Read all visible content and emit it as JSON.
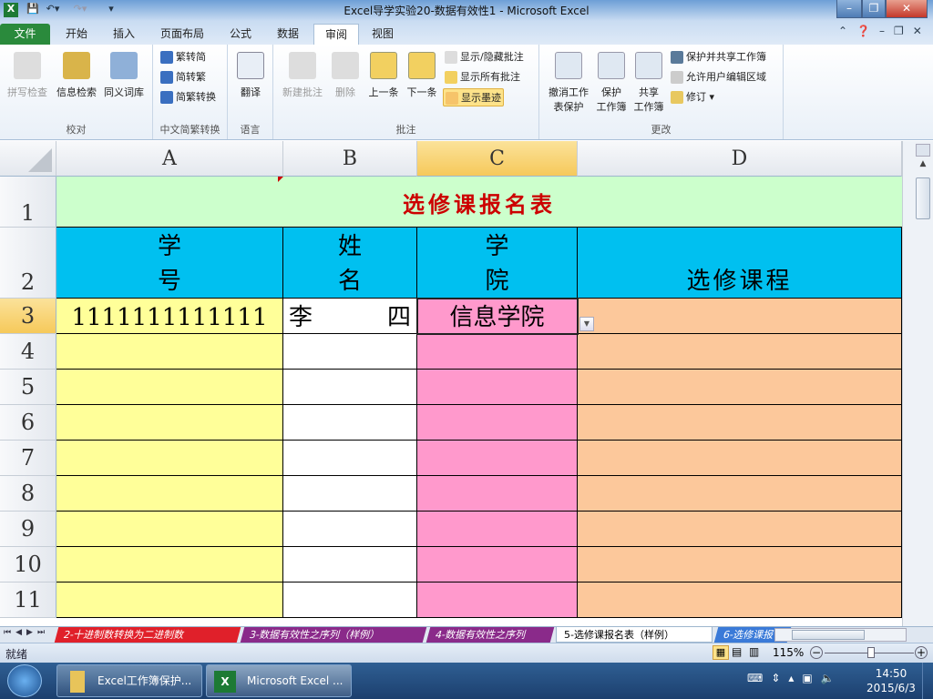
{
  "window": {
    "title": "Excel导学实验20-数据有效性1 - Microsoft Excel"
  },
  "tabs": [
    {
      "label": "文件"
    },
    {
      "label": "开始"
    },
    {
      "label": "插入"
    },
    {
      "label": "页面布局"
    },
    {
      "label": "公式"
    },
    {
      "label": "数据"
    },
    {
      "label": "审阅"
    },
    {
      "label": "视图"
    }
  ],
  "active_tab": "审阅",
  "ribbon": {
    "proofing": {
      "label": "校对",
      "items": [
        "拼写检查",
        "信息检索",
        "同义词库"
      ]
    },
    "chinese": {
      "label": "中文简繁转换",
      "items": [
        "繁转简",
        "简转繁",
        "简繁转换"
      ]
    },
    "language": {
      "label": "语言",
      "items": [
        "翻译"
      ]
    },
    "comments": {
      "label": "批注",
      "items": [
        "新建批注",
        "删除",
        "上一条",
        "下一条"
      ],
      "small": [
        "显示/隐藏批注",
        "显示所有批注",
        "显示墨迹"
      ]
    },
    "changes": {
      "label": "更改",
      "items": [
        "撤消工作表保护",
        "保护工作簿",
        "共享工作簿"
      ],
      "item_lines": [
        [
          "撤消工作",
          "表保护"
        ],
        [
          "保护",
          "工作簿"
        ],
        [
          "共享",
          "工作簿"
        ]
      ],
      "small": [
        "保护并共享工作簿",
        "允许用户编辑区域",
        "修订"
      ]
    }
  },
  "sheet": {
    "columns": [
      "A",
      "B",
      "C",
      "D"
    ],
    "selected_cell": "C3",
    "rows": [
      "1",
      "2",
      "3",
      "4",
      "5",
      "6",
      "7",
      "8",
      "9",
      "10",
      "11"
    ],
    "title": "选修课报名表",
    "headers": {
      "a": [
        "学",
        "号"
      ],
      "b": [
        "姓",
        "名"
      ],
      "c": [
        "学",
        "院"
      ],
      "d": "选修课程"
    },
    "row3": {
      "a": "1111111111111",
      "b1": "李",
      "b2": "四",
      "c": "信息学院",
      "d": ""
    },
    "colors": {
      "title_bg": "#ccffcc",
      "title_text": "#cc0000",
      "header_bg": "#00c0f0",
      "col_a": "#ffff99",
      "col_b": "#ffffff",
      "col_c": "#ff99cc",
      "col_d": "#fcc89b"
    }
  },
  "sheet_tabs": [
    {
      "label": "2-十进制数转换为二进制数",
      "color": "#e0202a"
    },
    {
      "label": "3-数据有效性之序列（样例）",
      "color": "#8a2a8a"
    },
    {
      "label": "4-数据有效性之序列",
      "color": "#8a2a8a"
    },
    {
      "label": "5-选修课报名表（样例）",
      "color": "#ffffff"
    },
    {
      "label": "6-选修课报",
      "color": "#3a7ad8"
    }
  ],
  "status": {
    "text": "就绪",
    "zoom": "115%"
  },
  "taskbar": {
    "items": [
      "Excel工作簿保护...",
      "Microsoft Excel ..."
    ],
    "time": "14:50",
    "date": "2015/6/3"
  }
}
